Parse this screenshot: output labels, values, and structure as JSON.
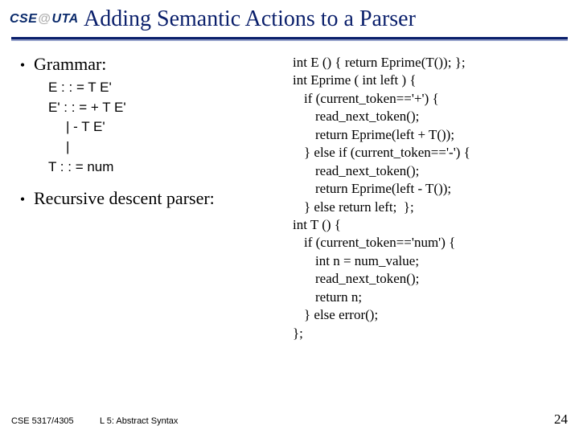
{
  "logo": {
    "left": "CSE",
    "at": "@",
    "right": "UTA"
  },
  "title": "Adding Semantic Actions to a Parser",
  "bullets": {
    "grammar": "Grammar:",
    "parser": "Recursive descent parser:"
  },
  "grammar": {
    "l1": "E : : = T E'",
    "l2": "E' : : = + T E'",
    "l3": "| - T E'",
    "l4": "|",
    "l5": "T : : = num"
  },
  "code": {
    "l1": "int E () { return Eprime(T()); };",
    "l2": "int Eprime ( int left ) {",
    "l3": "if (current_token=='+') {",
    "l4": "read_next_token();",
    "l5": "return Eprime(left + T());",
    "l6": "} else if (current_token=='-') {",
    "l7": "read_next_token();",
    "l8": "return Eprime(left - T());",
    "l9": "} else return left;  };",
    "l10": "int T () {",
    "l11": "if (current_token=='num') {",
    "l12": "int n = num_value;",
    "l13": "read_next_token();",
    "l14": "return n;",
    "l15": "} else error();",
    "l16": "};"
  },
  "footer": {
    "course": "CSE 5317/4305",
    "lecture": "L 5: Abstract Syntax",
    "page": "24"
  }
}
